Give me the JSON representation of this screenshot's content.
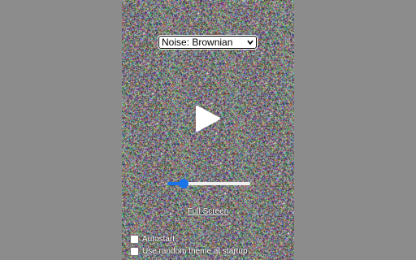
{
  "noise_select": {
    "selected": "Noise: Brownian"
  },
  "player": {
    "play_icon": "play-icon",
    "volume": 0.2
  },
  "fullscreen_link": "Full Screen",
  "options": {
    "autostart_label": "Autostart",
    "autostart_checked": false,
    "random_theme_label": "Use random theme at startup",
    "random_theme_checked": false
  },
  "colors": {
    "page_background": "#8c8c8c",
    "slider_accent": "#1a73e8"
  }
}
